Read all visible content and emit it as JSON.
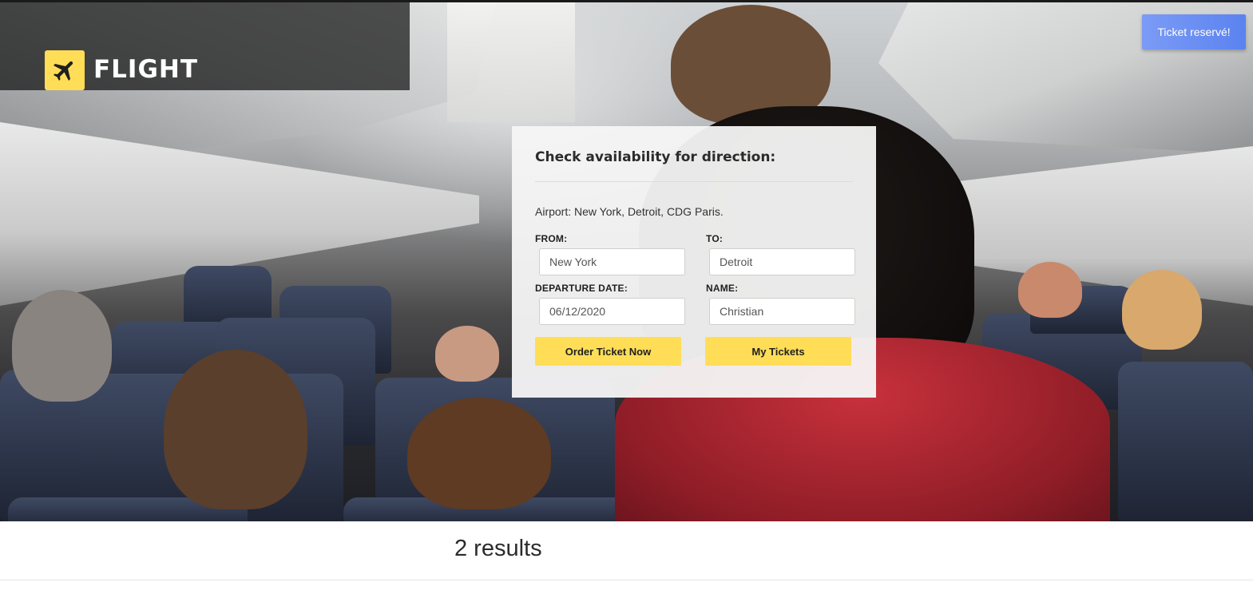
{
  "brand": {
    "name": "FLIGHT",
    "icon": "airplane-icon",
    "accent_color": "#ffdd57"
  },
  "header": {
    "reserve_button_label": "Ticket reservé!",
    "reserve_button_color": "#6b8ff2"
  },
  "search_card": {
    "title": "Check availability for direction:",
    "airports_text": "Airport: New York, Detroit, CDG Paris.",
    "from": {
      "label": "FROM:",
      "value": "New York"
    },
    "to": {
      "label": "TO:",
      "value": "Detroit"
    },
    "departure_date": {
      "label": "DEPARTURE DATE:",
      "value": "06/12/2020"
    },
    "name": {
      "label": "NAME:",
      "value": "Christian"
    },
    "order_button_label": "Order Ticket Now",
    "my_tickets_button_label": "My Tickets"
  },
  "results": {
    "summary": "2 results"
  }
}
